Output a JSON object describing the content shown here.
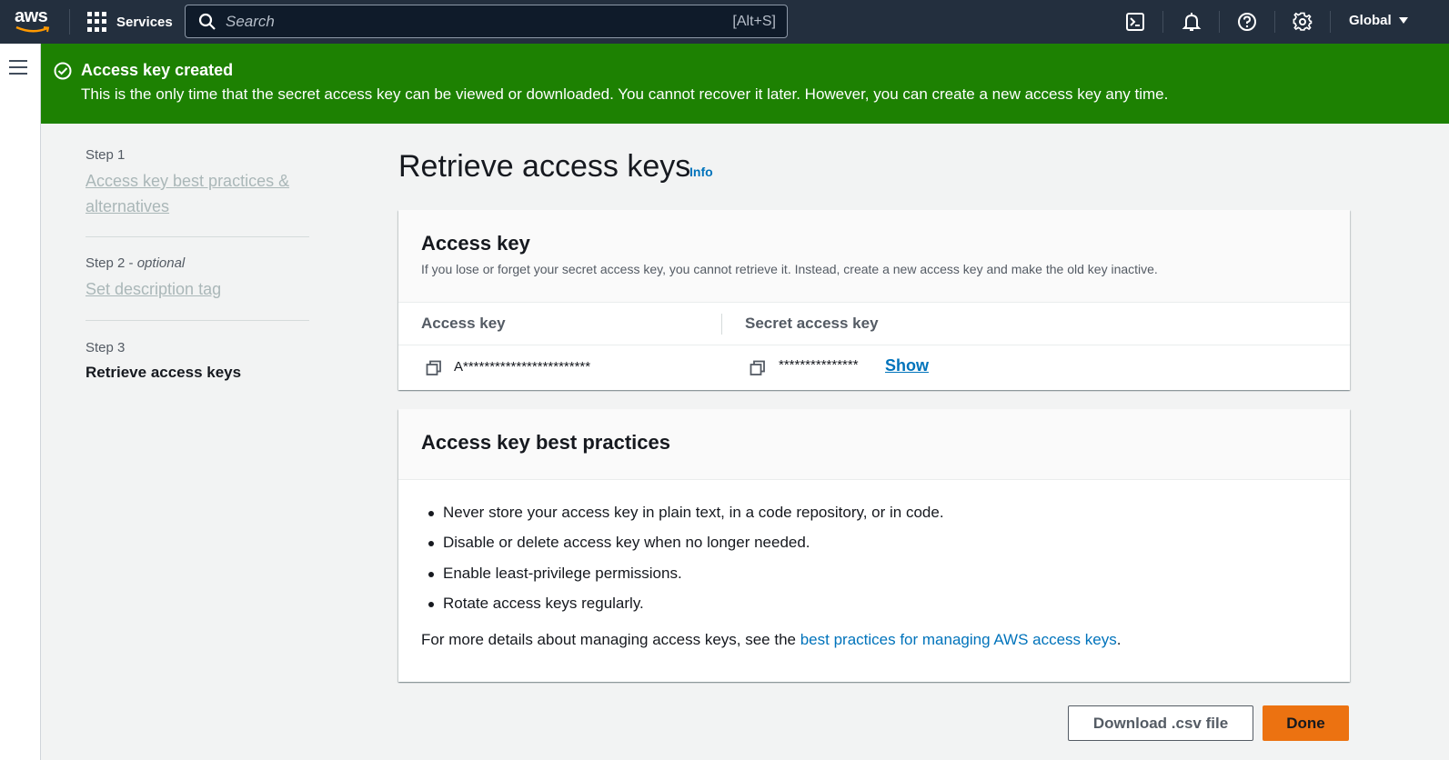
{
  "topnav": {
    "logo_text": "aws",
    "services_label": "Services",
    "search_placeholder": "Search",
    "search_shortcut": "[Alt+S]",
    "region_label": "Global",
    "icons": [
      "cloudshell-icon",
      "bell-icon",
      "help-icon",
      "gear-icon"
    ]
  },
  "flash": {
    "title": "Access key created",
    "message": "This is the only time that the secret access key can be viewed or downloaded. You cannot recover it later. However, you can create a new access key any time.",
    "color": "#1d8102"
  },
  "steps": [
    {
      "label": "Step 1",
      "title": "Access key best practices & alternatives"
    },
    {
      "label": "Step 2",
      "optional": "optional",
      "title": "Set description tag"
    },
    {
      "label": "Step 3",
      "title": "Retrieve access keys"
    }
  ],
  "page": {
    "title": "Retrieve access keys",
    "info_link": "Info"
  },
  "access_key_card": {
    "title": "Access key",
    "description": "If you lose or forget your secret access key, you cannot retrieve it. Instead, create a new access key and make the old key inactive.",
    "col_access_key": "Access key",
    "col_secret_key": "Secret access key",
    "access_key_value": "A************************",
    "secret_key_value": "***************",
    "show_link": "Show"
  },
  "best_practices_card": {
    "title": "Access key best practices",
    "items": [
      "Never store your access key in plain text, in a code repository, or in code.",
      "Disable or delete access key when no longer needed.",
      "Enable least-privilege permissions.",
      "Rotate access keys regularly."
    ],
    "more_prefix": "For more details about managing access keys, see the ",
    "more_link": "best practices for managing AWS access keys",
    "more_suffix": "."
  },
  "buttons": {
    "download": "Download .csv file",
    "done": "Done"
  },
  "colors": {
    "nav_bg": "#232f3e",
    "link": "#0073bb",
    "primary_button": "#ec7211"
  }
}
